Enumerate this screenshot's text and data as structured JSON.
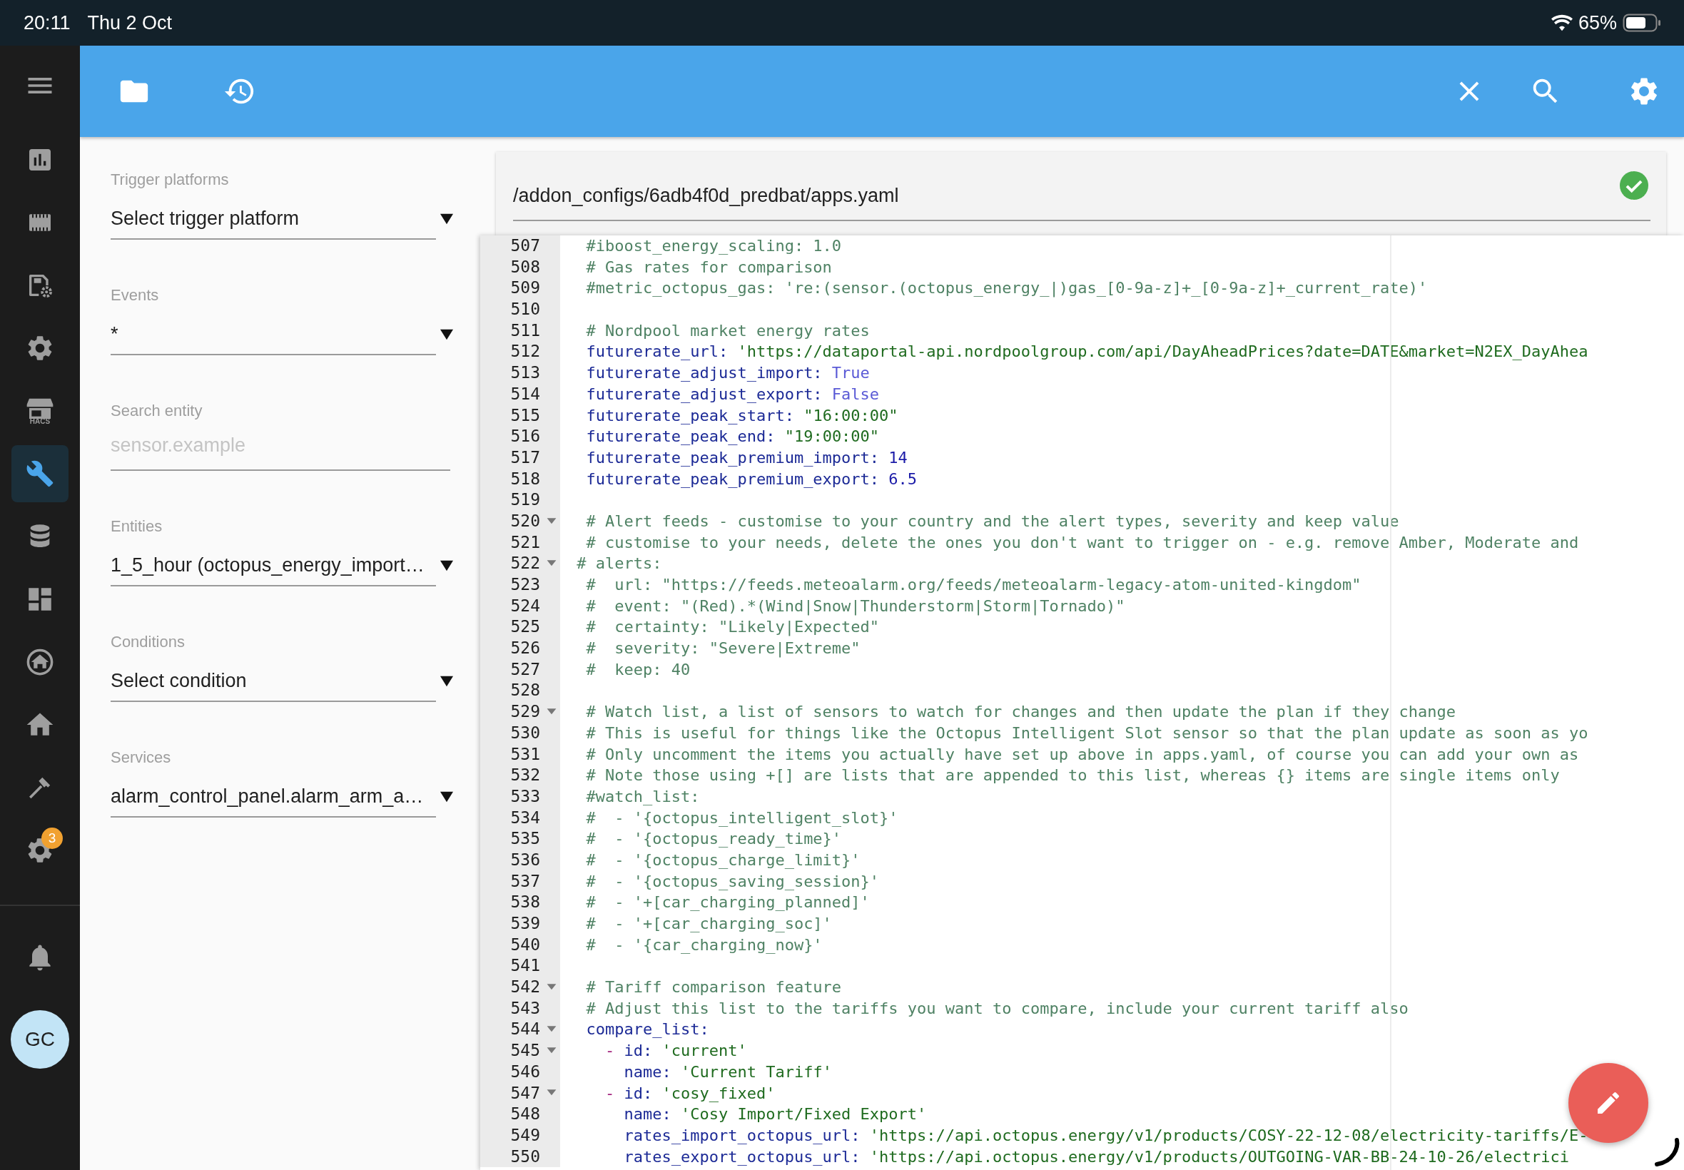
{
  "status_bar": {
    "time": "20:11",
    "date": "Thu 2 Oct",
    "battery": "65%"
  },
  "nav": {
    "items": [
      {
        "kind": "chart",
        "selected": false
      },
      {
        "kind": "chip",
        "selected": false
      },
      {
        "kind": "save-settings",
        "selected": false
      },
      {
        "kind": "gear",
        "selected": false
      },
      {
        "kind": "store",
        "caption": "HACS",
        "selected": false
      },
      {
        "kind": "wrench",
        "selected": true
      },
      {
        "kind": "database",
        "selected": false
      },
      {
        "kind": "dashboard",
        "selected": false
      },
      {
        "kind": "home-circle",
        "selected": false
      },
      {
        "kind": "home",
        "selected": false
      },
      {
        "kind": "hammer",
        "selected": false
      },
      {
        "kind": "gear",
        "badge": "3",
        "selected": false
      }
    ],
    "avatar": "GC"
  },
  "form": {
    "fields": [
      {
        "kind": "select",
        "label": "Trigger platforms",
        "value": "Select trigger platform"
      },
      {
        "kind": "select",
        "label": "Events",
        "value": "*"
      },
      {
        "kind": "search",
        "label": "Search entity",
        "placeholder": "sensor.example"
      },
      {
        "kind": "select",
        "label": "Entities",
        "value": "1_5_hour (octopus_energy_import…"
      },
      {
        "kind": "select",
        "label": "Conditions",
        "value": "Select condition"
      },
      {
        "kind": "select",
        "label": "Services",
        "value": "alarm_control_panel.alarm_arm_a…"
      }
    ]
  },
  "file": {
    "path": "/addon_configs/6adb4f0d_predbat/apps.yaml",
    "valid": true
  },
  "editor": {
    "lines": [
      {
        "number": "507",
        "foldable": false,
        "tokens": [
          {
            "kind": "comment",
            "text": "  #iboost_energy_scaling: 1.0"
          }
        ]
      },
      {
        "number": "508",
        "foldable": false,
        "tokens": [
          {
            "kind": "comment",
            "text": "  # Gas rates for comparison"
          }
        ]
      },
      {
        "number": "509",
        "foldable": false,
        "tokens": [
          {
            "kind": "comment",
            "text": "  #metric_octopus_gas: 're:(sensor.(octopus_energy_|)gas_[0-9a-z]+_[0-9a-z]+_current_rate)'"
          }
        ]
      },
      {
        "number": "510",
        "foldable": false
      },
      {
        "number": "511",
        "foldable": false,
        "tokens": [
          {
            "kind": "comment",
            "text": "  # Nordpool market energy rates"
          }
        ]
      },
      {
        "number": "512",
        "foldable": false,
        "tokens": [
          {
            "kind": "key",
            "text": "  futurerate_url:"
          },
          {
            "kind": "string",
            "text": " 'https://dataportal-api.nordpoolgroup.com/api/DayAheadPrices?date=DATE&market=N2EX_DayAhea"
          }
        ]
      },
      {
        "number": "513",
        "foldable": false,
        "tokens": [
          {
            "kind": "key",
            "text": "  futurerate_adjust_import:"
          },
          {
            "kind": "bool",
            "text": " True"
          }
        ]
      },
      {
        "number": "514",
        "foldable": false,
        "tokens": [
          {
            "kind": "key",
            "text": "  futurerate_adjust_export:"
          },
          {
            "kind": "bool",
            "text": " False"
          }
        ]
      },
      {
        "number": "515",
        "foldable": false,
        "tokens": [
          {
            "kind": "key",
            "text": "  futurerate_peak_start:"
          },
          {
            "kind": "string",
            "text": " \"16:00:00\""
          }
        ]
      },
      {
        "number": "516",
        "foldable": false,
        "tokens": [
          {
            "kind": "key",
            "text": "  futurerate_peak_end:"
          },
          {
            "kind": "string",
            "text": " \"19:00:00\""
          }
        ]
      },
      {
        "number": "517",
        "foldable": false,
        "tokens": [
          {
            "kind": "key",
            "text": "  futurerate_peak_premium_import:"
          },
          {
            "kind": "number",
            "text": " 14"
          }
        ]
      },
      {
        "number": "518",
        "foldable": false,
        "tokens": [
          {
            "kind": "key",
            "text": "  futurerate_peak_premium_export:"
          },
          {
            "kind": "number",
            "text": " 6.5"
          }
        ]
      },
      {
        "number": "519",
        "foldable": false
      },
      {
        "number": "520",
        "foldable": true,
        "tokens": [
          {
            "kind": "comment",
            "text": "  # Alert feeds - customise to your country and the alert types, severity and keep value"
          }
        ]
      },
      {
        "number": "521",
        "foldable": false,
        "tokens": [
          {
            "kind": "comment",
            "text": "  # customise to your needs, delete the ones you don't want to trigger on - e.g. remove Amber, Moderate and"
          }
        ]
      },
      {
        "number": "522",
        "foldable": true,
        "tokens": [
          {
            "kind": "comment",
            "text": " # alerts:"
          }
        ]
      },
      {
        "number": "523",
        "foldable": false,
        "tokens": [
          {
            "kind": "comment",
            "text": "  #  url: \"https://feeds.meteoalarm.org/feeds/meteoalarm-legacy-atom-united-kingdom\""
          }
        ]
      },
      {
        "number": "524",
        "foldable": false,
        "tokens": [
          {
            "kind": "comment",
            "text": "  #  event: \"(Red).*(Wind|Snow|Thunderstorm|Storm|Tornado)\""
          }
        ]
      },
      {
        "number": "525",
        "foldable": false,
        "tokens": [
          {
            "kind": "comment",
            "text": "  #  certainty: \"Likely|Expected\""
          }
        ]
      },
      {
        "number": "526",
        "foldable": false,
        "tokens": [
          {
            "kind": "comment",
            "text": "  #  severity: \"Severe|Extreme\""
          }
        ]
      },
      {
        "number": "527",
        "foldable": false,
        "tokens": [
          {
            "kind": "comment",
            "text": "  #  keep: 40"
          }
        ]
      },
      {
        "number": "528",
        "foldable": false
      },
      {
        "number": "529",
        "foldable": true,
        "tokens": [
          {
            "kind": "comment",
            "text": "  # Watch list, a list of sensors to watch for changes and then update the plan if they change"
          }
        ]
      },
      {
        "number": "530",
        "foldable": false,
        "tokens": [
          {
            "kind": "comment",
            "text": "  # This is useful for things like the Octopus Intelligent Slot sensor so that the plan update as soon as yo"
          }
        ]
      },
      {
        "number": "531",
        "foldable": false,
        "tokens": [
          {
            "kind": "comment",
            "text": "  # Only uncomment the items you actually have set up above in apps.yaml, of course you can add your own as"
          }
        ]
      },
      {
        "number": "532",
        "foldable": false,
        "tokens": [
          {
            "kind": "comment",
            "text": "  # Note those using +[] are lists that are appended to this list, whereas {} items are single items only"
          }
        ]
      },
      {
        "number": "533",
        "foldable": false,
        "tokens": [
          {
            "kind": "comment",
            "text": "  #watch_list:"
          }
        ]
      },
      {
        "number": "534",
        "foldable": false,
        "tokens": [
          {
            "kind": "comment",
            "text": "  #  - '{octopus_intelligent_slot}'"
          }
        ]
      },
      {
        "number": "535",
        "foldable": false,
        "tokens": [
          {
            "kind": "comment",
            "text": "  #  - '{octopus_ready_time}'"
          }
        ]
      },
      {
        "number": "536",
        "foldable": false,
        "tokens": [
          {
            "kind": "comment",
            "text": "  #  - '{octopus_charge_limit}'"
          }
        ]
      },
      {
        "number": "537",
        "foldable": false,
        "tokens": [
          {
            "kind": "comment",
            "text": "  #  - '{octopus_saving_session}'"
          }
        ]
      },
      {
        "number": "538",
        "foldable": false,
        "tokens": [
          {
            "kind": "comment",
            "text": "  #  - '+[car_charging_planned]'"
          }
        ]
      },
      {
        "number": "539",
        "foldable": false,
        "tokens": [
          {
            "kind": "comment",
            "text": "  #  - '+[car_charging_soc]'"
          }
        ]
      },
      {
        "number": "540",
        "foldable": false,
        "tokens": [
          {
            "kind": "comment",
            "text": "  #  - '{car_charging_now}'"
          }
        ]
      },
      {
        "number": "541",
        "foldable": false
      },
      {
        "number": "542",
        "foldable": true,
        "tokens": [
          {
            "kind": "comment",
            "text": "  # Tariff comparison feature"
          }
        ]
      },
      {
        "number": "543",
        "foldable": false,
        "tokens": [
          {
            "kind": "comment",
            "text": "  # Adjust this list to the tariffs you want to compare, include your current tariff also"
          }
        ]
      },
      {
        "number": "544",
        "foldable": true,
        "tokens": [
          {
            "kind": "key",
            "text": "  compare_list:"
          }
        ]
      },
      {
        "number": "545",
        "foldable": true,
        "tokens": [
          {
            "kind": "dash",
            "text": "    -"
          },
          {
            "kind": "key",
            "text": " id:"
          },
          {
            "kind": "string",
            "text": " 'current'"
          }
        ]
      },
      {
        "number": "546",
        "foldable": false,
        "tokens": [
          {
            "kind": "key",
            "text": "      name:"
          },
          {
            "kind": "string",
            "text": " 'Current Tariff'"
          }
        ]
      },
      {
        "number": "547",
        "foldable": true,
        "tokens": [
          {
            "kind": "dash",
            "text": "    -"
          },
          {
            "kind": "key",
            "text": " id:"
          },
          {
            "kind": "string",
            "text": " 'cosy_fixed'"
          }
        ]
      },
      {
        "number": "548",
        "foldable": false,
        "tokens": [
          {
            "kind": "key",
            "text": "      name:"
          },
          {
            "kind": "string",
            "text": " 'Cosy Import/Fixed Export'"
          }
        ]
      },
      {
        "number": "549",
        "foldable": false,
        "tokens": [
          {
            "kind": "key",
            "text": "      rates_import_octopus_url:"
          },
          {
            "kind": "string",
            "text": " 'https://api.octopus.energy/v1/products/COSY-22-12-08/electricity-tariffs/E-"
          }
        ]
      },
      {
        "number": "550",
        "foldable": false,
        "tokens": [
          {
            "kind": "key",
            "text": "      rates_export_octopus_url:"
          },
          {
            "kind": "string",
            "text": " 'https://api.octopus.energy/v1/products/OUTGOING-VAR-BB-24-10-26/electrici"
          }
        ]
      }
    ]
  }
}
